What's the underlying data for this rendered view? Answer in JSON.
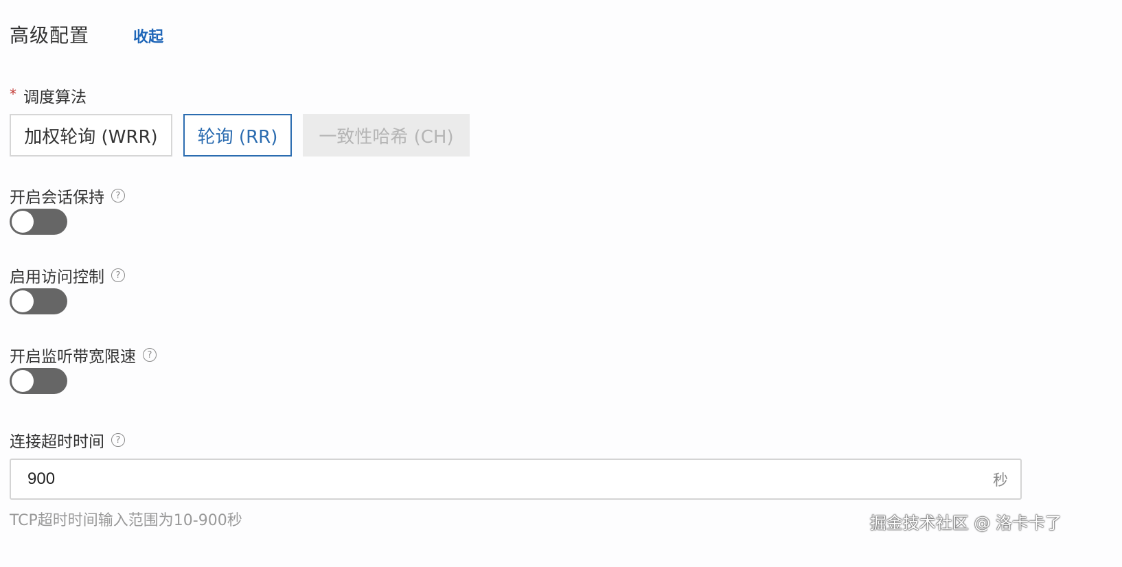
{
  "header": {
    "title": "高级配置",
    "collapse_label": "收起"
  },
  "scheduling": {
    "required_mark": "*",
    "label": "调度算法",
    "options": [
      {
        "label": "加权轮询 (WRR)",
        "state": "normal"
      },
      {
        "label": "轮询 (RR)",
        "state": "selected"
      },
      {
        "label": "一致性哈希 (CH)",
        "state": "disabled"
      }
    ]
  },
  "session_persistence": {
    "label": "开启会话保持",
    "enabled": false
  },
  "access_control": {
    "label": "启用访问控制",
    "enabled": false
  },
  "bandwidth_limit": {
    "label": "开启监听带宽限速",
    "enabled": false
  },
  "connection_timeout": {
    "label": "连接超时时间",
    "value": "900",
    "unit": "秒",
    "hint": "TCP超时时间输入范围为10-900秒"
  },
  "help_glyph": "?",
  "watermark": "掘金技术社区 @ 洛卡卡了",
  "colors": {
    "accent": "#2b6cb0",
    "link": "#1f66b8",
    "required": "#c23934",
    "toggle_off": "#666666",
    "disabled_bg": "#ebebeb"
  }
}
